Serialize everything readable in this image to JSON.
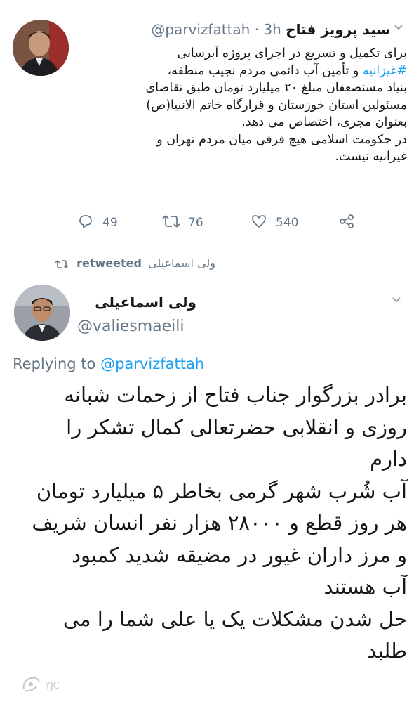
{
  "tweet1": {
    "name": "سید پرویز فتاح",
    "handle_time": "@parvizfattah · 3h",
    "body_before_hashtag": "برای تکمیل و تسریع در اجرای پروژه آبرسانی",
    "hashtag": "#غیزانیه",
    "body_after_hashtag": " و تأمین آب دائمی مردم نجیب منطقه،",
    "line3": "بنیاد مستضعفان مبلغ ۲۰ میلیارد تومان طبق تقاضای",
    "line4": "مسئولین استان خوزستان و قرارگاه خاتم الانبیا(ص)",
    "line5": "بعنوان مجری، اختصاص می دهد.",
    "line6": "در حکومت اسلامی هیچ فرقی میان مردم تهران و",
    "line7": "غیزانیه نیست.",
    "reply_count": "49",
    "retweet_count": "76",
    "like_count": "540"
  },
  "retweet_line": {
    "retweeter": "ولی اسماعیلی",
    "label": "retweeted"
  },
  "tweet2": {
    "name": "ولی اسماعیلی",
    "handle": "@valiesmaeili",
    "replying_prefix": "Replying to",
    "replying_handle": "@parvizfattah",
    "lines": [
      "برادر بزرگوار جناب فتاح از زحمات شبانه",
      "روزی و انقلابی حضرتعالی کمال تشکر را",
      "دارم",
      "آب شُرب شهر گرمی بخاطر ۵ میلیارد تومان",
      "هر روز قطع و ۲۸۰۰۰ هزار نفر انسان شریف",
      "و  مرز داران غیور در مضیقه شدید کمبود",
      "آب هستند",
      "حل شدن مشکلات یک یا علی شما را می",
      "طلبد"
    ]
  },
  "watermark": {
    "label": "YJC"
  },
  "icons": {
    "caret": "chevron-down-icon",
    "reply": "reply-icon",
    "retweet": "retweet-icon",
    "like": "heart-icon",
    "share": "share-icon"
  },
  "colors": {
    "link": "#1da1f2",
    "muted": "#657786",
    "text": "#14171a"
  }
}
